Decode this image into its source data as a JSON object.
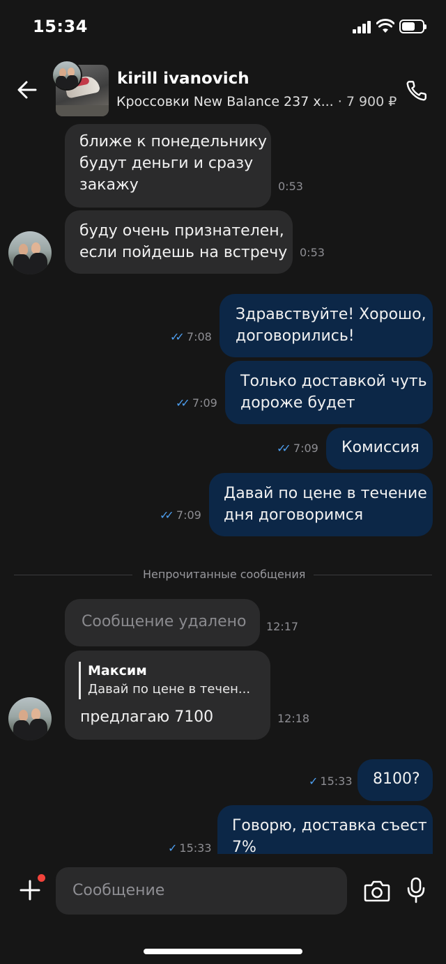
{
  "status": {
    "time": "15:34"
  },
  "header": {
    "name": "kirill ivanovich",
    "product": "Кроссовки New Balance 237 х...",
    "price": "· 7 900 ₽"
  },
  "messages": [
    {
      "dir": "in",
      "text": "ближе к понедельнику\nбудут деньги и сразу\nзакажу",
      "time": "0:53"
    },
    {
      "dir": "in",
      "text": "буду очень признателен,\nесли пойдешь на встречу",
      "time": "0:53"
    },
    {
      "dir": "out",
      "text": "Здравствуйте! Хорошо,\nдоговорились!",
      "time": "7:08"
    },
    {
      "dir": "out",
      "text": "Только доставкой чуть\nдороже будет",
      "time": "7:09"
    },
    {
      "dir": "out",
      "text": "Комиссия",
      "time": "7:09"
    },
    {
      "dir": "out",
      "text": "Давай по цене в течение\nдня договоримся",
      "time": "7:09"
    },
    {
      "dir": "in",
      "text": "Сообщение удалено",
      "time": "12:17"
    },
    {
      "dir": "in",
      "reply_name": "Максим",
      "reply_text": "Давай по цене в течен...",
      "text": "предлагаю 7100",
      "time": "12:18"
    },
    {
      "dir": "out",
      "text": "8100?",
      "time": "15:33"
    },
    {
      "dir": "out",
      "text": "Говорю, доставка съест\n7%",
      "time": "15:33"
    }
  ],
  "divider": "Непрочитанные сообщения",
  "composer": {
    "placeholder": "Сообщение"
  },
  "colors": {
    "background": "#161616",
    "incoming": "#2b2b2c",
    "outgoing": "#0c2747",
    "read_check": "#4e9ff0",
    "badge": "#f2433b"
  }
}
